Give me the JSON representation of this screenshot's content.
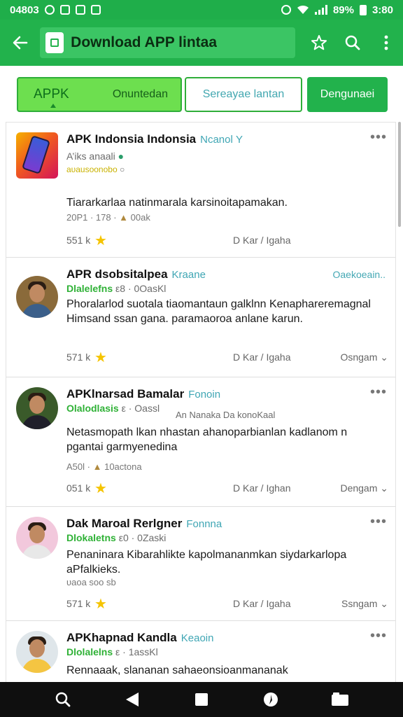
{
  "status_bar": {
    "time": "3:80",
    "battery": "89%",
    "left_code": "04803"
  },
  "app_bar": {
    "title": "Download APP lintaa"
  },
  "filters": {
    "primary": "APPK",
    "primary_secondary": "Onuntedan",
    "middle": "Sereayae lantan",
    "action": "Dengunaei"
  },
  "cards": [
    {
      "title": "APK Indonsia Indonsia",
      "tag": "Ncanol Υ",
      "sub1": "A’iks anaali",
      "sub2": "aυausoonobo",
      "body": "Tiararkarlaa natinmarala karsinoitapamakan.",
      "meta_a": "20P1 · 178",
      "meta_b": "00ak",
      "count": "551 k",
      "mid": "D Kar / Igaha",
      "right": ""
    },
    {
      "title": "APR dsobsitalpea",
      "tag": "Kraane",
      "side": "Oaekoeain..",
      "sub1": "Dlalelefns",
      "sub2": "ε8 · 0OasKl",
      "body": "Phoralarlod suotala tiaomantaun galklnn Kenaphareremagnal Himsand ssan gana. paramaoroa anlane karun.",
      "count": "571 k",
      "mid": "D Kar / Igaha",
      "right": "Osngam"
    },
    {
      "title": "APKlnarsad Bamalar",
      "tag": "Fonoin",
      "sub1": "Olalodlasis",
      "sub2": "ε · Oassl",
      "note": "An Nanaka Da konoKaal",
      "body": "Netasmopath lkan nhastan ahanoparbianlan kadlanom n pgantai garmyenedina",
      "meta_a": "A50l",
      "meta_b": "10actona",
      "count": "051 k",
      "mid": "D Kar / Ighan",
      "right": "Dengam"
    },
    {
      "title": "Dak Maroal Rerlgner",
      "tag": "Fonnna",
      "sub1": "Dlokaletns",
      "sub2": "ε0 · 0Zaski",
      "body": "Penaninara Kibarahlikte kapolmananmkan siydarkarlopa aPfalkieks.",
      "meta_a": "υaoa soo sb",
      "count": "571 k",
      "mid": "D Kar / Igaha",
      "right": "Ssngam"
    },
    {
      "title": "APKhapnad Kandla",
      "tag": "Keaoin",
      "sub1": "Dlolalelns",
      "sub2": "ε · 1assKl",
      "body": "Rennaaak, slananan sahaeonsioanmananak"
    }
  ],
  "colors": {
    "accent": "#22b24c",
    "primary_pill": "#6ddf4f",
    "link": "#3fa6b4",
    "star": "#f5c400"
  }
}
